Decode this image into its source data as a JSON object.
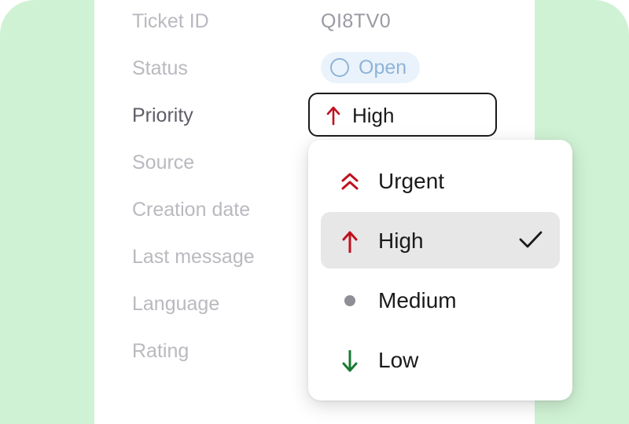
{
  "colors": {
    "background_green": "#d0f2d4",
    "urgent": "#c0111f",
    "high": "#c0111f",
    "medium": "#8e8e96",
    "low": "#1a7a34",
    "status": "#8fb3d8"
  },
  "fields": {
    "ticket_id_label": "Ticket ID",
    "ticket_id_value": "QI8TV0",
    "status_label": "Status",
    "status_value": "Open",
    "priority_label": "Priority",
    "priority_value": "High",
    "source_label": "Source",
    "creation_date_label": "Creation date",
    "last_message_label": "Last message",
    "language_label": "Language",
    "rating_label": "Rating"
  },
  "priority_dropdown": {
    "options": [
      {
        "label": "Urgent",
        "icon": "double-chevron-up-icon"
      },
      {
        "label": "High",
        "icon": "arrow-up-icon",
        "selected": true
      },
      {
        "label": "Medium",
        "icon": "dot-icon"
      },
      {
        "label": "Low",
        "icon": "arrow-down-icon"
      }
    ]
  }
}
